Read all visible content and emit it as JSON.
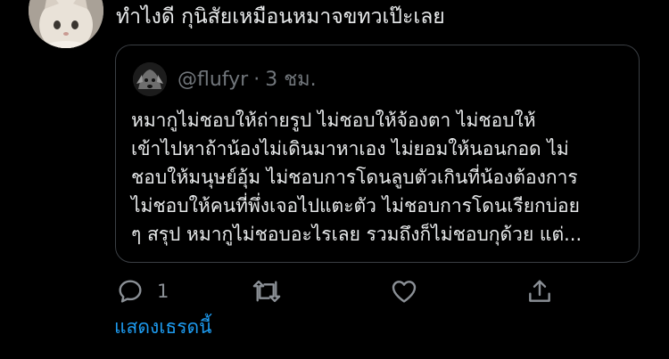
{
  "tweet": {
    "text": "ทำไงดี กุนิสัยเหมือนหมาจขทวเป๊ะเลย",
    "avatar_icon": "cat-avatar"
  },
  "quote": {
    "handle": "@flufyr",
    "separator": "·",
    "time": "3 ชม.",
    "avatar_icon": "dog-avatar",
    "lines": [
      "หมากูไม่ชอบให้ถ่ายรูป ไม่ชอบให้จ้องตา ไม่ชอบให้",
      "เข้าไปหาถ้าน้องไม่เดินมาหาเอง ไม่ยอมให้นอนกอด ไม่",
      "ชอบให้มนุษย์อุ้ม ไม่ชอบการโดนลูบตัวเกินที่น้องต้องการ",
      "ไม่ชอบให้คนที่พึ่งเจอไปแตะตัว ไม่ชอบการโดนเรียกบ่อย",
      "ๆ สรุป หมากูไม่ชอบอะไรเลย รวมถึงก็ไม่ชอบกุด้วย แต่..."
    ]
  },
  "actions": {
    "reply": {
      "icon": "reply-icon",
      "count": "1"
    },
    "retweet": {
      "icon": "retweet-icon"
    },
    "like": {
      "icon": "heart-icon"
    },
    "share": {
      "icon": "share-icon"
    }
  },
  "show_thread": "แสดงเธรดนี้",
  "colors": {
    "background": "#000000",
    "text": "#e7e9ea",
    "muted": "#71767b",
    "border": "#3b3f44",
    "link": "#1d9bf0"
  }
}
